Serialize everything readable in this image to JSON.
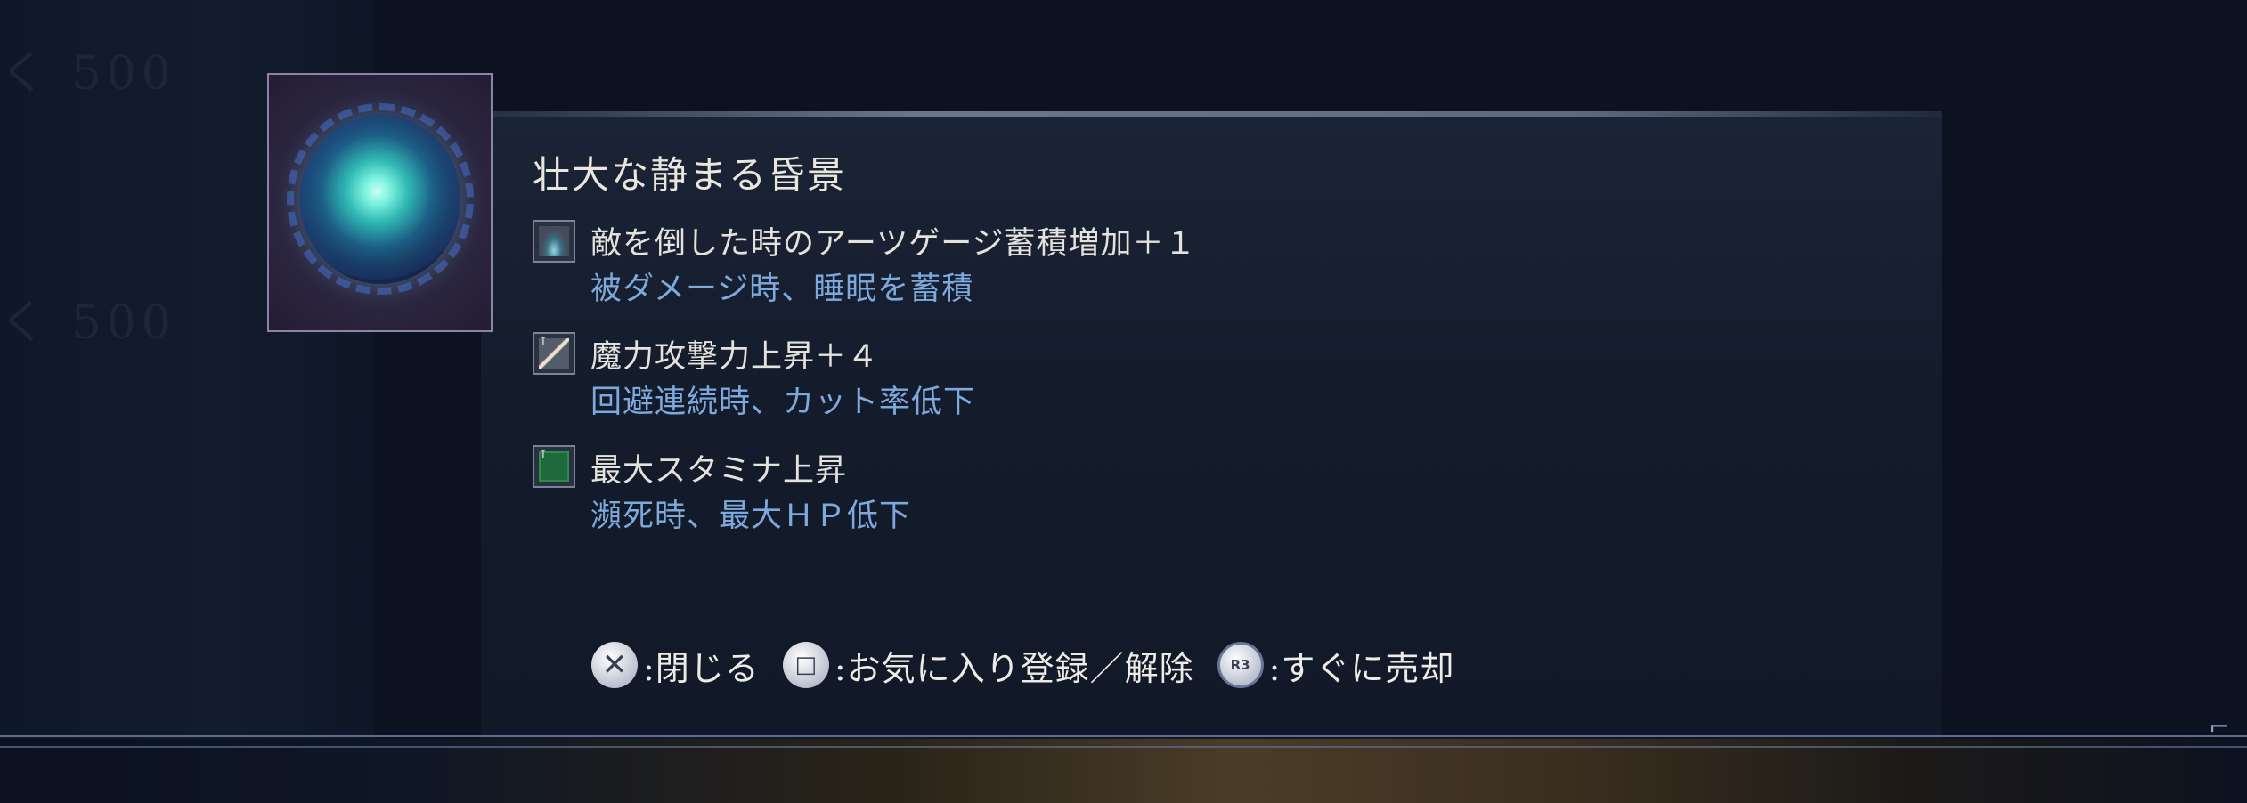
{
  "background": {
    "ghost_text_1": "く 500",
    "ghost_text_2": "く 500"
  },
  "item": {
    "name": "壮大な静まる昏景",
    "thumbnail": "swirling-blue-orb-relic"
  },
  "effects": [
    {
      "icon": "ripple-icon",
      "main": "敵を倒した時のアーツゲージ蓄積増加＋１",
      "sub": "被ダメージ時、睡眠を蓄積"
    },
    {
      "icon": "sword-up-icon",
      "main": "魔力攻撃力上昇＋４",
      "sub": "回避連続時、カット率低下"
    },
    {
      "icon": "stamina-up-icon",
      "main": "最大スタミナ上昇",
      "sub": "瀕死時、最大ＨＰ低下"
    }
  ],
  "button_hints": [
    {
      "icon": "cross-button-icon",
      "glyph": "✕",
      "label": ":閉じる"
    },
    {
      "icon": "square-button-icon",
      "glyph": "□",
      "label": ":お気に入り登録／解除"
    },
    {
      "icon": "r3-button-icon",
      "glyph": "R3",
      "label": ":すぐに売却"
    }
  ],
  "colors": {
    "title_text": "#e9e6de",
    "effect_main_text": "#e4e2dc",
    "effect_sub_text": "#7ea9dc",
    "panel_bg": "#141c2c",
    "thumb_border": "#8f82a8",
    "divider": "#5b6d8f"
  }
}
